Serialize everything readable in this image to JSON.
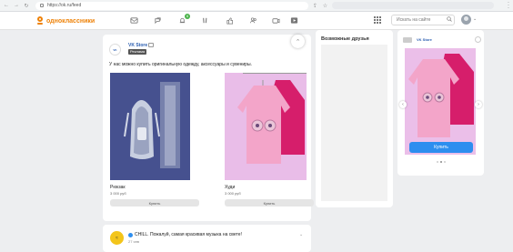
{
  "browser": {
    "url": "https://ok.ru/feed"
  },
  "header": {
    "logo_text": "одноклассники",
    "notification_count": "6",
    "search_placeholder": "Искать на сайте"
  },
  "post": {
    "author": "VK Store",
    "tag": "Реклама",
    "text": "У нас можно купить оригинальную одежду, аксессуары и сувениры.",
    "products": [
      {
        "title": "Рюкзак",
        "price": "3 000 руб",
        "buy_label": "Купить"
      },
      {
        "title": "Худи",
        "price": "3 000 руб",
        "buy_label": "Купить"
      }
    ]
  },
  "music_post": {
    "title": "CHILL. Пожалуй, самая красивая музыка на свете!",
    "time": "27 янв"
  },
  "friends": {
    "title": "Возможные друзья"
  },
  "ad": {
    "name": "VK Store",
    "buy_label": "Купить"
  }
}
